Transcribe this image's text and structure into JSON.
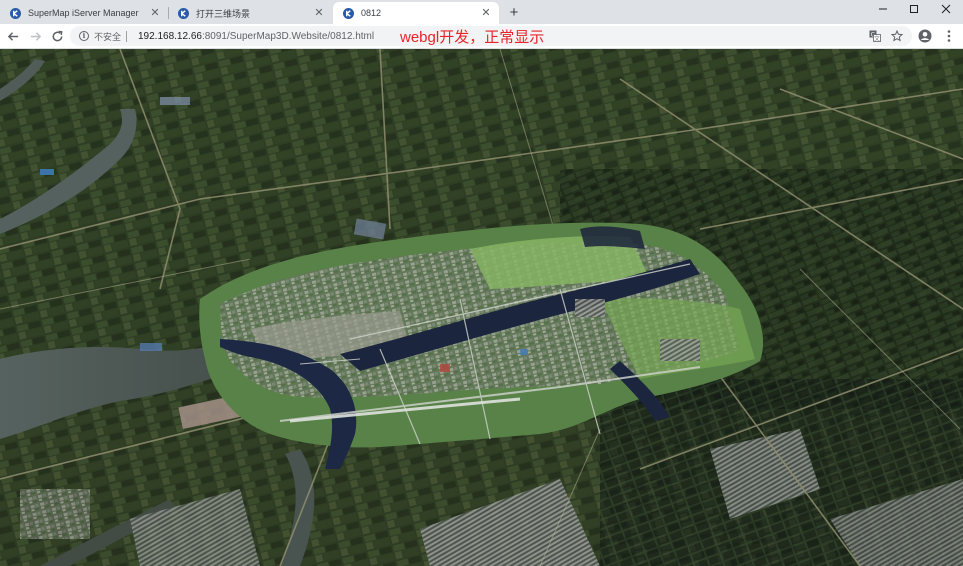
{
  "tabs": [
    {
      "title": "SuperMap iServer Manager",
      "active": false
    },
    {
      "title": "打开三维场景",
      "active": false
    },
    {
      "title": "0812",
      "active": true
    }
  ],
  "toolbar": {
    "security_label": "不安全",
    "url_host": "192.168.12.66",
    "url_rest": ":8091/SuperMap3D.Website/0812.html",
    "annotation": "webgl开发，正常显示"
  },
  "icons": {
    "back": "arrow-left-icon",
    "forward": "arrow-right-icon",
    "reload": "reload-icon",
    "info": "info-icon",
    "translate": "translate-icon",
    "bookmark": "star-icon",
    "profile": "account-icon",
    "menu": "kebab-menu-icon"
  },
  "colors": {
    "annotation": "#e8242a",
    "tab_bar": "#dee1e6",
    "favicon": "#2a5aa8"
  }
}
